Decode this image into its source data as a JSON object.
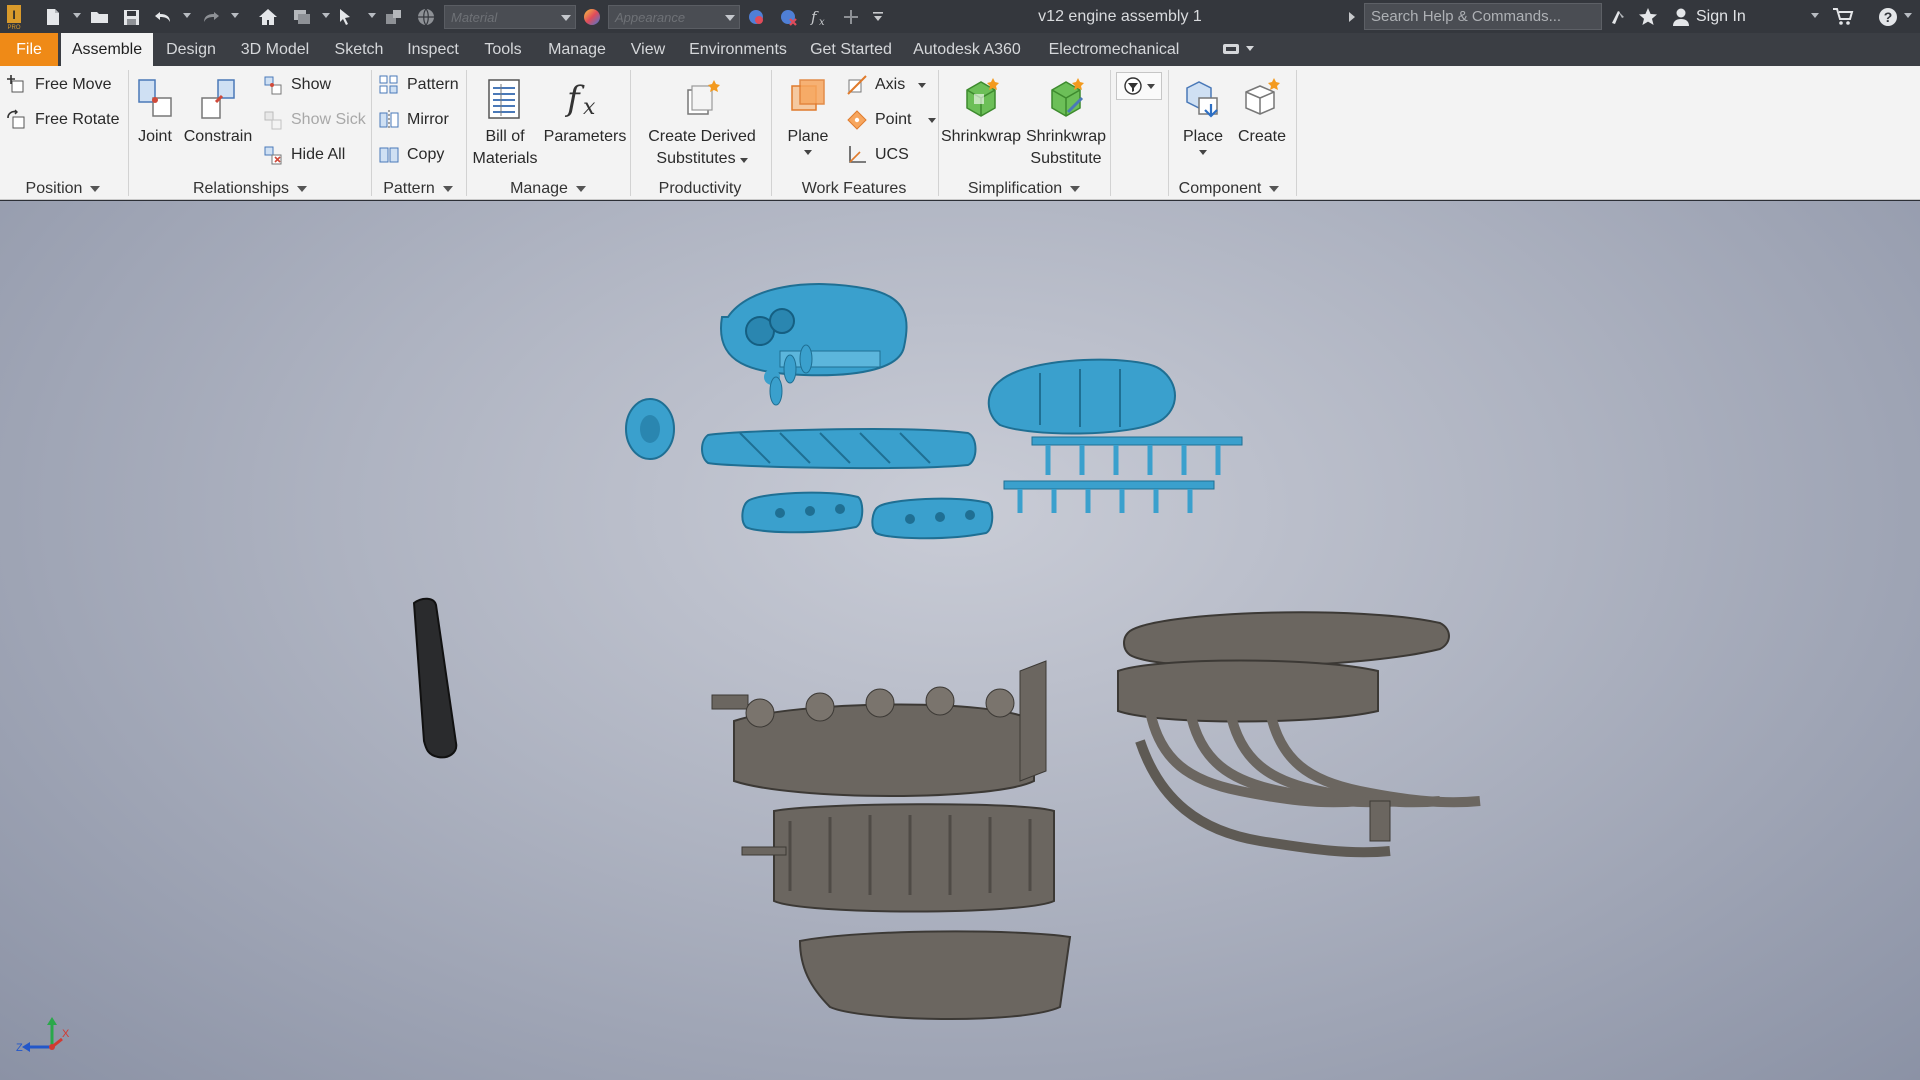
{
  "app": {
    "document_title": "v12 engine assembly 1"
  },
  "quick_access": {
    "material_placeholder": "Material",
    "appearance_placeholder": "Appearance"
  },
  "search": {
    "placeholder": "Search Help & Commands..."
  },
  "user": {
    "sign_in_label": "Sign In"
  },
  "menu_tabs": [
    {
      "label": "File"
    },
    {
      "label": "Assemble"
    },
    {
      "label": "Design"
    },
    {
      "label": "3D Model"
    },
    {
      "label": "Sketch"
    },
    {
      "label": "Inspect"
    },
    {
      "label": "Tools"
    },
    {
      "label": "Manage"
    },
    {
      "label": "View"
    },
    {
      "label": "Environments"
    },
    {
      "label": "Get Started"
    },
    {
      "label": "Autodesk A360"
    },
    {
      "label": "Electromechanical"
    }
  ],
  "ribbon": {
    "position": {
      "panel": "Position",
      "free_move": "Free Move",
      "free_rotate": "Free Rotate"
    },
    "relationships": {
      "panel": "Relationships",
      "joint": "Joint",
      "constrain": "Constrain",
      "show": "Show",
      "show_sick": "Show Sick",
      "hide_all": "Hide All"
    },
    "pattern": {
      "panel": "Pattern",
      "pattern": "Pattern",
      "mirror": "Mirror",
      "copy": "Copy"
    },
    "manage": {
      "panel": "Manage",
      "bill_of_materials_1": "Bill of",
      "bill_of_materials_2": "Materials",
      "parameters": "Parameters"
    },
    "productivity": {
      "panel": "Productivity",
      "create_derived_1": "Create Derived",
      "create_derived_2": "Substitutes"
    },
    "work_features": {
      "panel": "Work Features",
      "plane": "Plane",
      "axis": "Axis",
      "point": "Point",
      "ucs": "UCS"
    },
    "simplification": {
      "panel": "Simplification",
      "shrinkwrap": "Shrinkwrap",
      "shrinkwrap_substitute_1": "Shrinkwrap",
      "shrinkwrap_substitute_2": "Substitute"
    },
    "component": {
      "panel": "Component",
      "place": "Place",
      "create": "Create"
    }
  },
  "viewport": {
    "triad": {
      "x_label": "X",
      "y_label": "Y",
      "z_label": "Z"
    }
  },
  "colors": {
    "accent_file_tab": "#ef8a17",
    "part_blue": "#3aa0cd",
    "part_gray": "#6b6660",
    "part_black": "#2a2b2d"
  }
}
